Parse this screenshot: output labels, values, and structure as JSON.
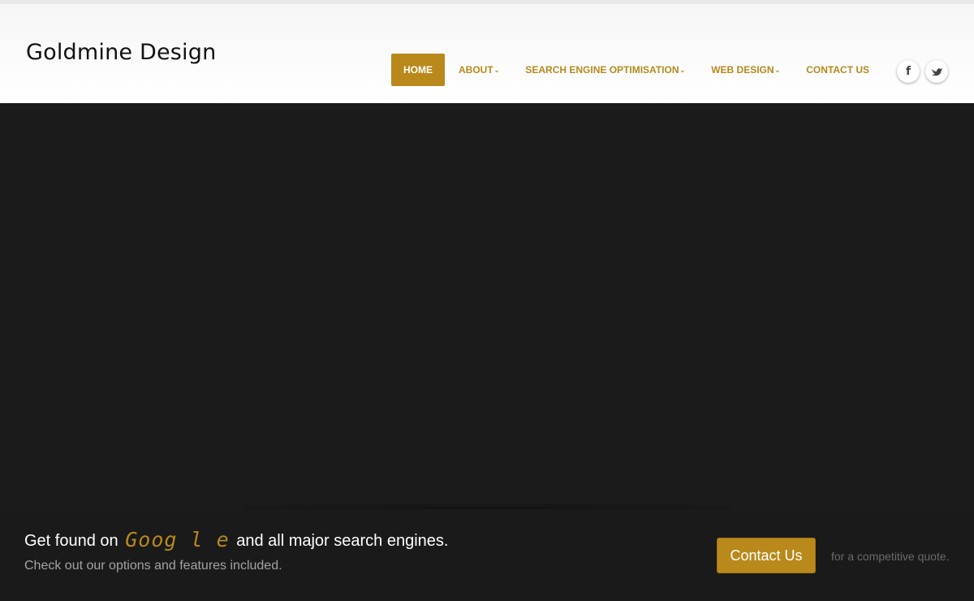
{
  "header": {
    "logo": "Goldmine Design"
  },
  "nav": {
    "items": [
      {
        "label": "HOME",
        "active": true
      },
      {
        "label": "ABOUT",
        "has_dropdown": true
      },
      {
        "label": "SEARCH ENGINE OPTIMISATION",
        "has_dropdown": true
      },
      {
        "label": "WEB DESIGN",
        "has_dropdown": true
      },
      {
        "label": "CONTACT US"
      }
    ],
    "chevron": "⌄"
  },
  "social": {
    "facebook_glyph": "f",
    "twitter_icon": "twitter-icon"
  },
  "cta": {
    "headline_before": "Get found on",
    "google_text": "Goog l e",
    "headline_after": "and all major search engines.",
    "subtext": "Check out our options and features included.",
    "button_label": "Contact Us",
    "note": "for a competitive quote."
  },
  "colors": {
    "accent": "#b9891b",
    "nav_text": "#b58a1c",
    "hero_bg": "#1b1b1b"
  }
}
